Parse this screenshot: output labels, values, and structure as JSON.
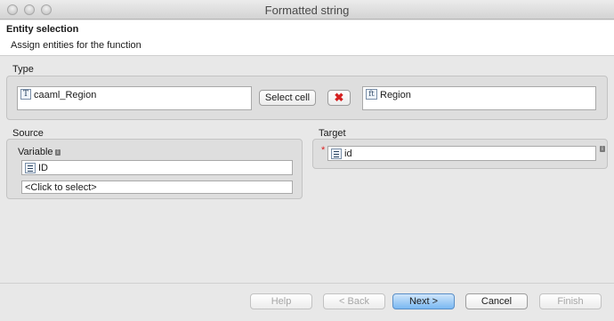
{
  "window": {
    "title": "Formatted string"
  },
  "header": {
    "title": "Entity selection",
    "subtitle": "Assign entities for the function"
  },
  "type_group": {
    "label": "Type",
    "source_value": "caaml_Region",
    "source_icon": "T",
    "select_cell_label": "Select cell",
    "remove_icon": "✖",
    "target_value": "Region",
    "target_icon": "ft"
  },
  "source_group": {
    "label": "Source",
    "variable_label": "Variable",
    "variable_value": "ID",
    "click_to_select": "<Click to select>"
  },
  "target_group": {
    "label": "Target",
    "required_marker": "*",
    "value": "id"
  },
  "footer": {
    "help": "Help",
    "back": "< Back",
    "next": "Next >",
    "cancel": "Cancel",
    "finish": "Finish"
  },
  "colors": {
    "default_button": "#7ab8f2",
    "required": "#dd2222",
    "remove": "#d42020"
  },
  "icons": [
    "close-icon",
    "minimize-icon",
    "zoom-icon",
    "type-icon",
    "feature-type-icon",
    "list-icon",
    "info-icon",
    "remove-icon"
  ]
}
